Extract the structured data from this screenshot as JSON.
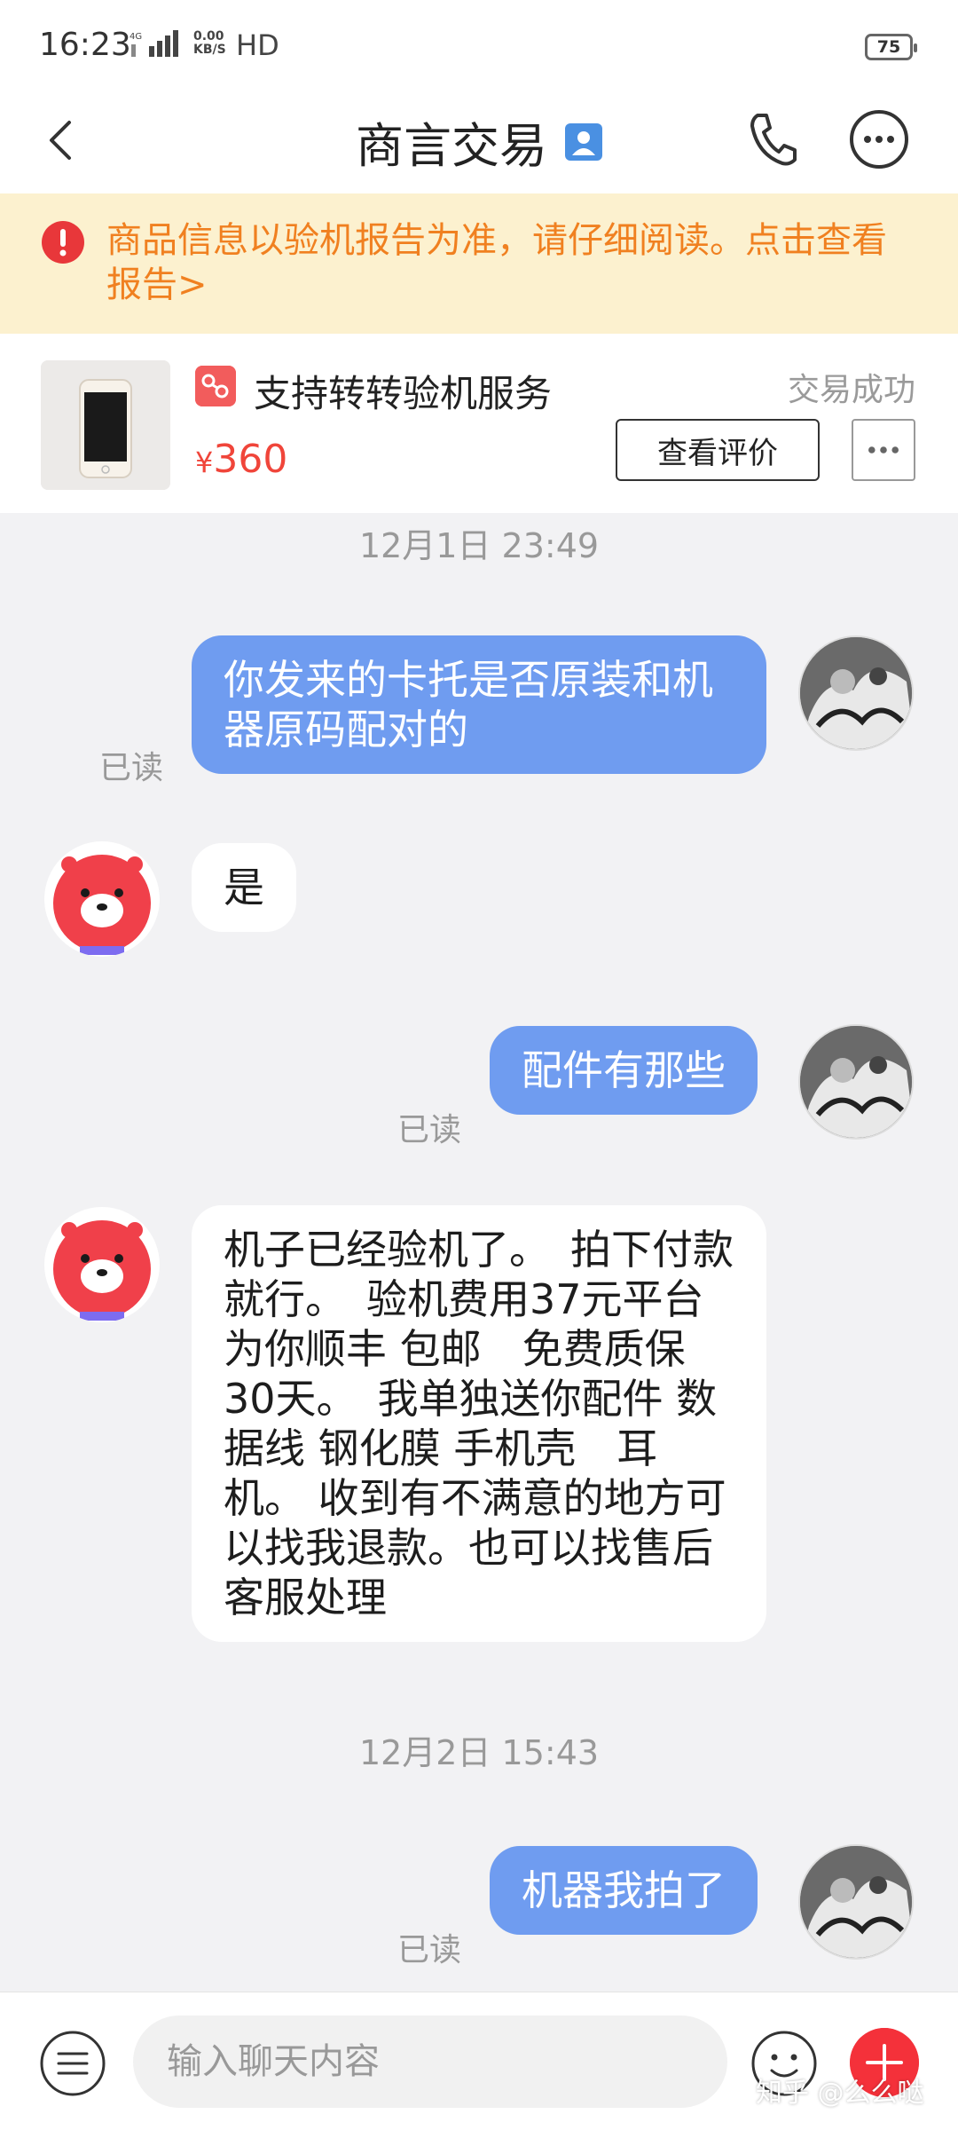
{
  "status_bar": {
    "time": "16:23",
    "network_label": "4G",
    "net_speed_value": "0.00",
    "net_speed_unit": "KB/S",
    "hd": "HD",
    "battery": "75"
  },
  "header": {
    "title": "商言交易",
    "badge_icon": "contact-card-icon",
    "phone_icon": "phone-icon",
    "more_icon": "more-icon"
  },
  "notice": {
    "text": "商品信息以验机报告为准，请仔细阅读。点击查看报告>",
    "color": "#f08020",
    "background": "#fcf1cf"
  },
  "product": {
    "service_label": "支持转转验机服务",
    "price_symbol": "¥",
    "price": "360",
    "status": "交易成功",
    "review_button": "查看评价"
  },
  "messages": {
    "ts1": "12月1日 23:49",
    "m1": "你发来的卡托是否原装和机器原码配对的",
    "m2": "是",
    "m3": "配件有那些",
    "m4": "机子已经验机了。　拍下付款就行。　验机费用37元平台为你顺丰 包邮　免费质保30天。　我单独送你配件 数据线 钢化膜 手机壳　耳机。 收到有不满意的地方可以找我退款。也可以找售后客服处理",
    "ts2": "12月2日 15:43",
    "m5": "机器我拍了",
    "read_label": "已读"
  },
  "input_bar": {
    "placeholder": "输入聊天内容",
    "watermark": "知乎 @么么哒"
  },
  "colors": {
    "outgoing_bubble": "#6f9cf0",
    "price": "#f0453a",
    "accent_red": "#f4313a"
  }
}
